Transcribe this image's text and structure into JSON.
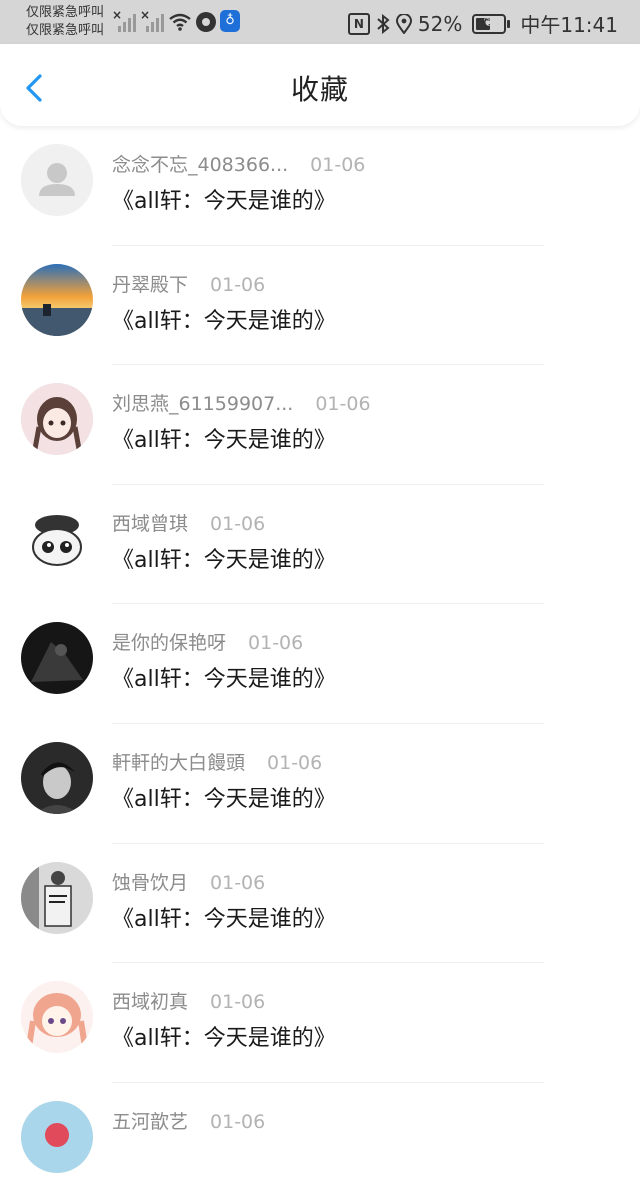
{
  "status_bar": {
    "carrier_line1": "仅限紧急呼叫",
    "carrier_line2": "仅限紧急呼叫",
    "nfc": "N",
    "battery": "52%",
    "time": "中午11:41"
  },
  "header": {
    "title": "收藏",
    "back_icon": "chevron-left-icon"
  },
  "items": [
    {
      "user": "念念不忘_408366...",
      "date": "01-06",
      "title": "《all轩：今天是谁的》",
      "avatar": "default-person-icon"
    },
    {
      "user": "丹翠殿下",
      "date": "01-06",
      "title": "《all轩：今天是谁的》",
      "avatar": "sunset-photo"
    },
    {
      "user": "刘思燕_61159907...",
      "date": "01-06",
      "title": "《all轩：今天是谁的》",
      "avatar": "anime-girl"
    },
    {
      "user": "西域曾琪",
      "date": "01-06",
      "title": "《all轩：今天是谁的》",
      "avatar": "cartoon-face"
    },
    {
      "user": "是你的保艳呀",
      "date": "01-06",
      "title": "《all轩：今天是谁的》",
      "avatar": "dark-photo"
    },
    {
      "user": "軒軒的大白饅頭",
      "date": "01-06",
      "title": "《all轩：今天是谁的》",
      "avatar": "bw-portrait"
    },
    {
      "user": "蚀骨饮月",
      "date": "01-06",
      "title": "《all轩：今天是谁的》",
      "avatar": "street-photo"
    },
    {
      "user": "西域初真",
      "date": "01-06",
      "title": "《all轩：今天是谁的》",
      "avatar": "anime-pink-girl"
    },
    {
      "user": "五河歆艺",
      "date": "01-06",
      "title": "",
      "avatar": "icecream-photo"
    }
  ]
}
